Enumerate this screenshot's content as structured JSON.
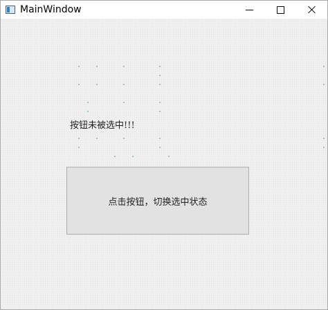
{
  "window": {
    "title": "MainWindow"
  },
  "label": {
    "text": "按钮未被选中!!!"
  },
  "button": {
    "text": "点击按钮，切换选中状态"
  }
}
